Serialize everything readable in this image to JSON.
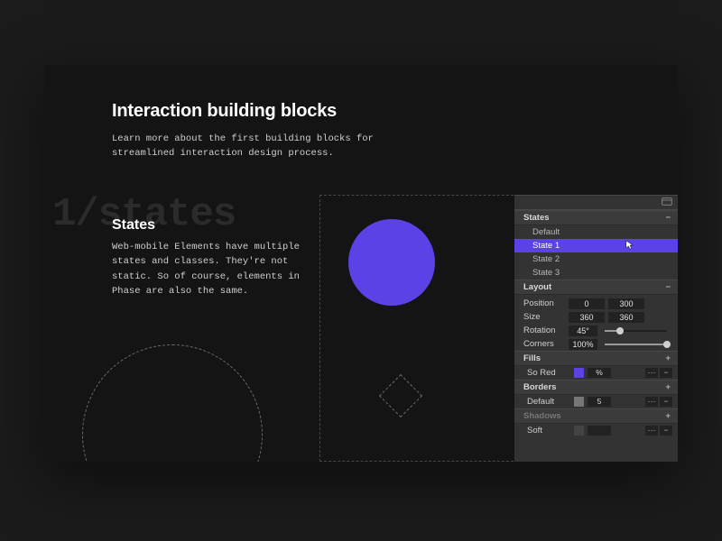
{
  "header": {
    "title": "Interaction building blocks",
    "lead": "Learn more about the first building blocks for streamlined interaction design process."
  },
  "section": {
    "bg_label": "1/states",
    "title": "States",
    "body": "Web-mobile Elements have multiple states and classes. They're not static. So of course, elements in Phase are also the same."
  },
  "panel": {
    "states": {
      "header": "States",
      "items": [
        "Default",
        "State 1",
        "State 2",
        "State 3"
      ],
      "selected": "State 1"
    },
    "layout": {
      "header": "Layout",
      "position_label": "Position",
      "position": [
        "0",
        "300"
      ],
      "size_label": "Size",
      "size": [
        "360",
        "360"
      ],
      "rotation_label": "Rotation",
      "rotation": "45°",
      "rotation_pct": 25,
      "corners_label": "Corners",
      "corners": "100%",
      "corners_pct": 100
    },
    "fills": {
      "header": "Fills",
      "item_label": "So Red",
      "alpha": "%",
      "color": "#5a42e6"
    },
    "borders": {
      "header": "Borders",
      "item_label": "Default",
      "thickness": "5"
    },
    "shadows": {
      "header": "Shadows",
      "item_label": "Soft"
    },
    "icons": {
      "minus": "−",
      "plus": "+",
      "dots": "⋯"
    }
  }
}
